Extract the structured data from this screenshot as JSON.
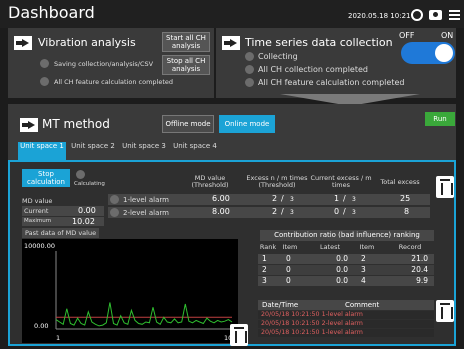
{
  "header": {
    "title": "Dashboard",
    "datetime": "2020.05.18 10:21"
  },
  "vibration": {
    "title": "Vibration analysis",
    "start_btn": "Start all CH analysis",
    "stop_btn": "Stop all CH analysis",
    "status1": "Saving collection/analysis/CSV",
    "status2": "All CH feature calculation completed"
  },
  "timeseries": {
    "title": "Time series data collection",
    "toggle_off": "OFF",
    "toggle_on": "ON",
    "status1": "Collecting",
    "status2": "All CH collection completed",
    "status3": "All CH feature calculation completed"
  },
  "mt": {
    "title": "MT method",
    "offline": "Offline mode",
    "online": "Online mode",
    "run": "Run"
  },
  "tabs": [
    "Unit space 1",
    "Unit space 2",
    "Unit space 3",
    "Unit space 4"
  ],
  "panel": {
    "stop_calc": "Stop calculation",
    "calculating": "Calculating",
    "md_value_label": "MD value",
    "current_label": "Current",
    "current_value": "0.00",
    "maximum_label": "Maximum",
    "maximum_value": "10.02",
    "past_label": "Past data of MD value"
  },
  "thresholds": {
    "headers": [
      "MD value (Threshold)",
      "Excess n / m times (Threshold)",
      "Current excess / m times",
      "Total excess"
    ],
    "rows": [
      {
        "name": "1-level alarm",
        "md": "6.00",
        "n": "2",
        "m": "3",
        "cur": "1",
        "cm": "3",
        "total": "25"
      },
      {
        "name": "2-level alarm",
        "md": "8.00",
        "n": "2",
        "m": "3",
        "cur": "0",
        "cm": "3",
        "total": "8"
      }
    ]
  },
  "chart": {
    "y_top": "10000.00",
    "y_bottom": "0.00",
    "x_start": "1",
    "x_end": "100"
  },
  "chart_data": {
    "type": "line",
    "x": [
      1,
      100
    ],
    "ylim": [
      0,
      10000
    ],
    "series": [
      {
        "values": [
          1200,
          900,
          600,
          2600,
          700,
          500,
          1400,
          700,
          500,
          2200,
          900,
          600,
          400,
          500,
          800,
          3400,
          700,
          500,
          1700,
          800,
          600,
          2400,
          1100,
          700,
          600,
          900,
          800,
          2800,
          900,
          600,
          1500,
          900,
          800,
          1300,
          800,
          900,
          3200,
          1000,
          800,
          1100,
          900,
          700,
          1400,
          1000,
          800,
          1100,
          900,
          1000,
          1200,
          900
        ]
      }
    ]
  },
  "ranking": {
    "title": "Contribution ratio (bad influence) ranking",
    "headers": [
      "Rank",
      "Item",
      "Latest",
      "Item",
      "Record"
    ],
    "rows": [
      [
        "1",
        "0",
        "0.0",
        "2",
        "21.0"
      ],
      [
        "2",
        "0",
        "0.0",
        "3",
        "20.4"
      ],
      [
        "3",
        "0",
        "0.0",
        "4",
        "9.9"
      ]
    ]
  },
  "log": {
    "headers": [
      "Date/Time",
      "Comment"
    ],
    "rows": [
      "20/05/18 10:21:50 1-level alarm",
      "20/05/18 10:21:50 2-level alarm",
      "20/05/18 10:21:50 1-level alarm"
    ]
  }
}
